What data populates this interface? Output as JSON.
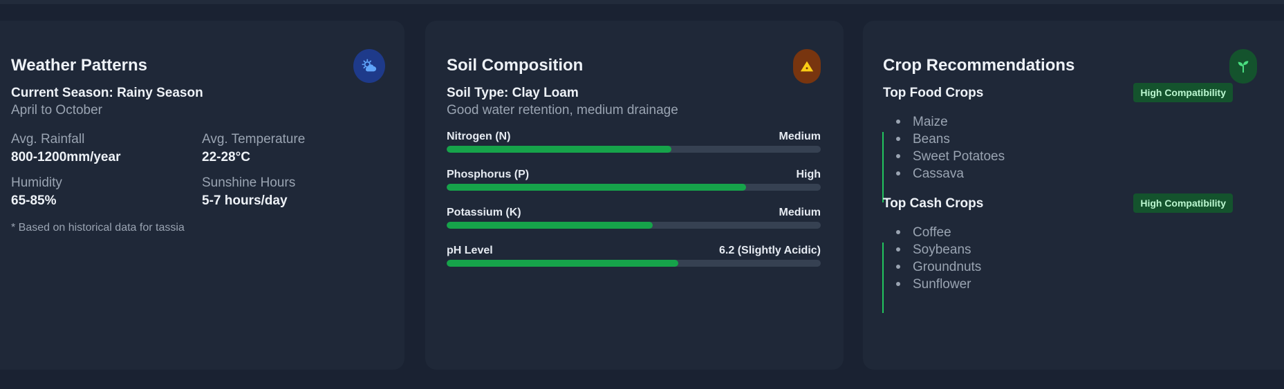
{
  "weather": {
    "title": "Weather Patterns",
    "icon": "cloud-sun-icon",
    "season_label": "Current Season: Rainy Season",
    "season_range": "April to October",
    "stats": [
      {
        "label": "Avg. Rainfall",
        "value": "800-1200mm/year"
      },
      {
        "label": "Avg. Temperature",
        "value": "22-28°C"
      },
      {
        "label": "Humidity",
        "value": "65-85%"
      },
      {
        "label": "Sunshine Hours",
        "value": "5-7 hours/day"
      }
    ],
    "note": "* Based on historical data for tassia"
  },
  "soil": {
    "title": "Soil Composition",
    "icon": "mountain-icon",
    "soil_type": "Soil Type: Clay Loam",
    "description": "Good water retention, medium drainage",
    "nutrients": [
      {
        "label": "Nitrogen (N)",
        "value": "Medium",
        "level": 0.6
      },
      {
        "label": "Phosphorus (P)",
        "value": "High",
        "level": 0.8
      },
      {
        "label": "Potassium (K)",
        "value": "Medium",
        "level": 0.55
      },
      {
        "label": "pH Level",
        "value": "6.2 (Slightly Acidic)",
        "level": 0.62
      }
    ]
  },
  "crops": {
    "title": "Crop Recommendations",
    "icon": "seedling-icon",
    "groups": [
      {
        "label": "Top Food Crops",
        "badge": "High Compatibility",
        "items": [
          "Maize",
          "Beans",
          "Sweet Potatoes",
          "Cassava"
        ]
      },
      {
        "label": "Top Cash Crops",
        "badge": "High Compatibility",
        "items": [
          "Coffee",
          "Soybeans",
          "Groundnuts",
          "Sunflower"
        ]
      }
    ]
  },
  "colors": {
    "background": "#1a2232",
    "card": "#1f2838",
    "accent_green": "#16a34a",
    "weather_icon_bg": "#1e3a8a",
    "soil_icon_bg": "#78350f",
    "crops_icon_bg": "#14532d"
  }
}
